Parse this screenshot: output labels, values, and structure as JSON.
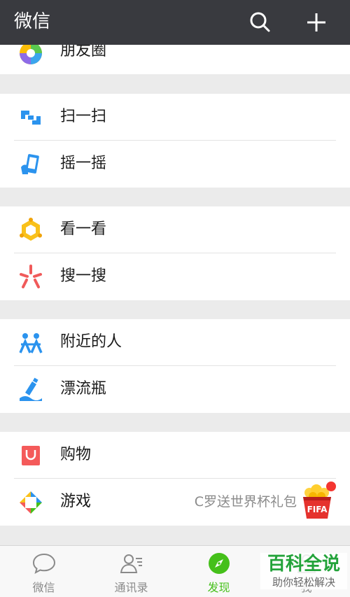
{
  "header": {
    "title": "微信"
  },
  "discover": {
    "moments": "朋友圈",
    "scan": "扫一扫",
    "shake": "摇一摇",
    "top_stories": "看一看",
    "search": "搜一搜",
    "people_nearby": "附近的人",
    "drift_bottle": "漂流瓶",
    "shopping": "购物",
    "games": "游戏",
    "games_promo": "C罗送世界杯礼包",
    "fifa_badge": "FIFA"
  },
  "tabs": [
    {
      "label": "微信"
    },
    {
      "label": "通讯录"
    },
    {
      "label": "发现"
    },
    {
      "label": "我"
    }
  ],
  "watermark": {
    "line1": "百科全说",
    "line2": "助你轻松解决"
  },
  "colors": {
    "header": "#393a3f",
    "active": "#45c01a",
    "badge": "#f43530"
  }
}
